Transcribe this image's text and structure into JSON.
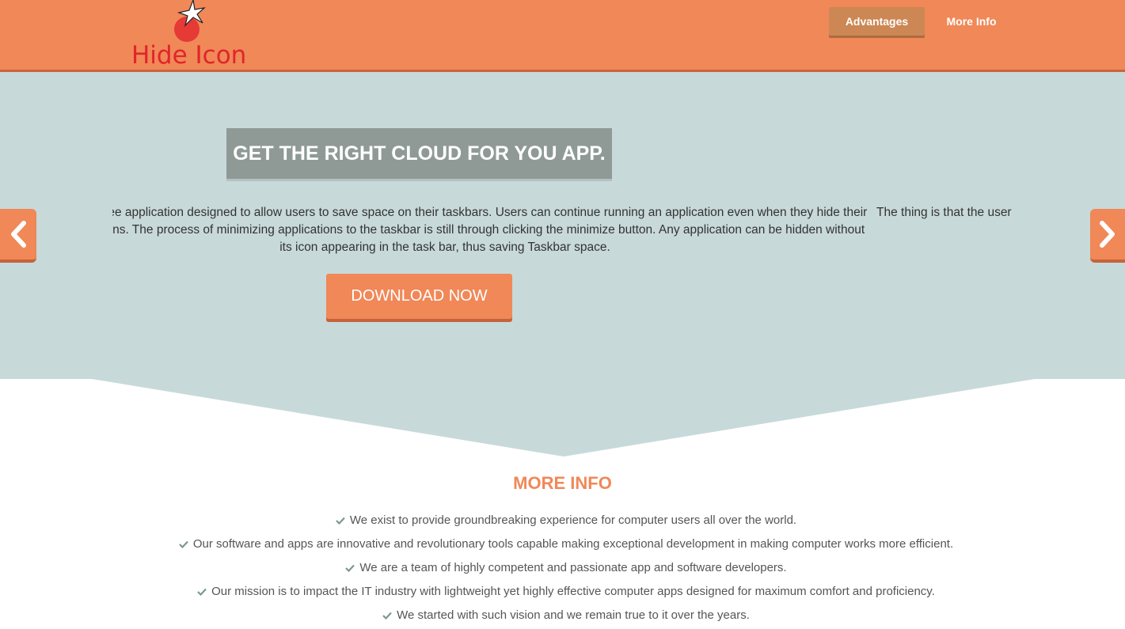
{
  "header": {
    "logo_text": "Hide Icon",
    "nav": [
      {
        "label": "Advantages",
        "active": true
      },
      {
        "label": "More Info",
        "active": false
      }
    ]
  },
  "hero": {
    "title": "GET THE RIGHT CLOUD FOR YOU APP.",
    "slides": [
      "Hide Icon is a free application designed to allow users to save space on their taskbars. Users can continue running an application even when they hide their System Tray icons. The process of minimizing applications to the taskbar is still through clicking the minimize button. Any application can be hidden without its icon appearing in the task bar, thus saving Taskbar space.",
      "The thing is that the user can still work with the application while its icon is absent from the taskbar."
    ],
    "download_label": "DOWNLOAD NOW",
    "prev_icon": "chevron-left-icon",
    "next_icon": "chevron-right-icon"
  },
  "more_info": {
    "title": "MORE INFO",
    "items": [
      "We exist to provide groundbreaking experience for computer users all over the world.",
      "Our software and apps are innovative and revolutionary tools capable making exceptional development in making computer works more efficient.",
      "We are a team of highly competent and passionate app and software developers.",
      "Our mission is to impact the IT industry with lightweight yet highly effective computer apps designed for maximum comfort and proficiency.",
      "We started with such vision and we remain true to it over the years."
    ]
  },
  "colors": {
    "accent": "#f08858",
    "hero_bg": "#c8d9d9",
    "title_bg": "#8f9a97",
    "logo_red": "#e0252a",
    "check_green": "#7a9a8a"
  }
}
